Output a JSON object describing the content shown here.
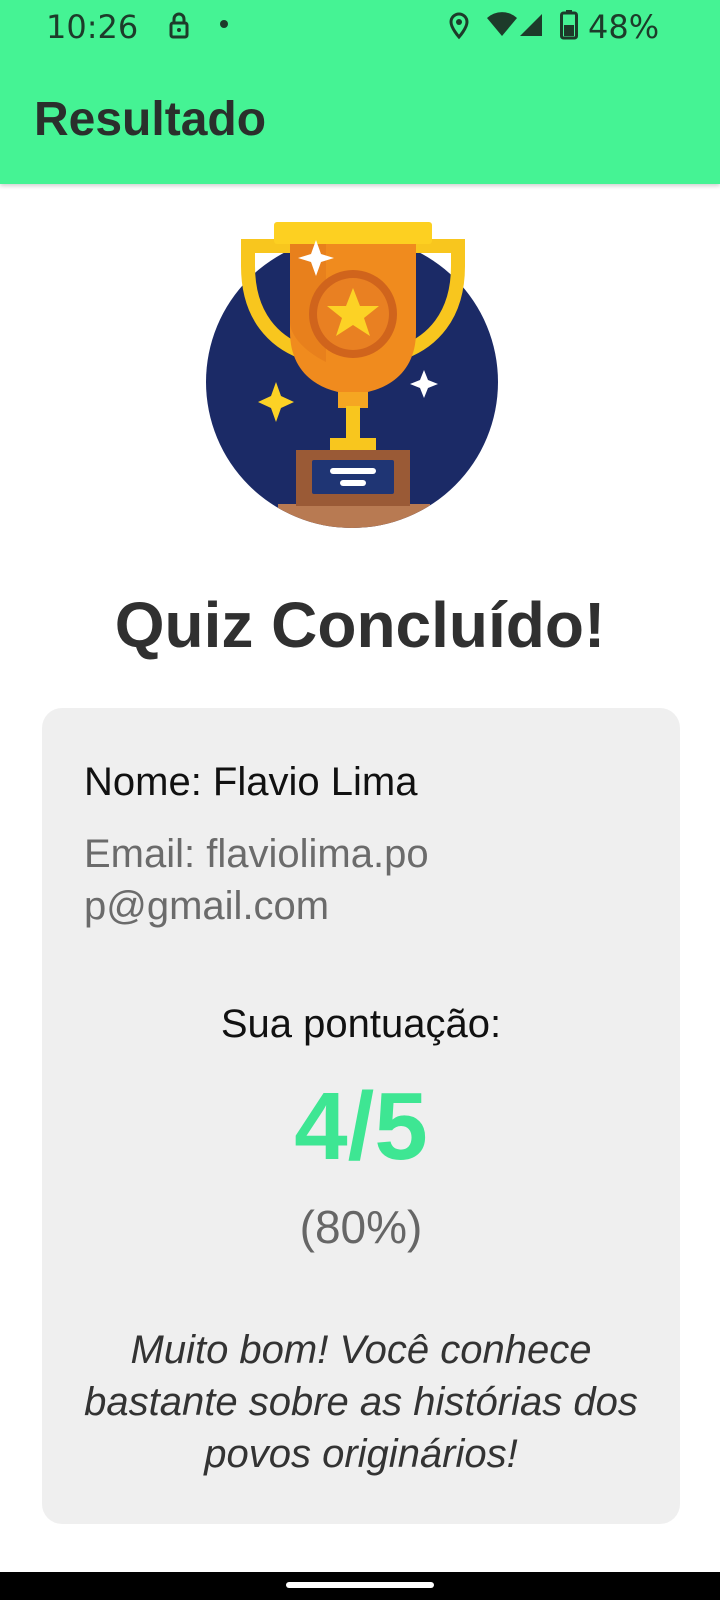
{
  "status_bar": {
    "time": "10:26",
    "battery_percent": "48%",
    "icons": [
      "lock-icon",
      "notification-dot-icon",
      "location-icon",
      "wifi-icon",
      "signal-icon",
      "battery-icon"
    ]
  },
  "app_bar": {
    "title": "Resultado",
    "color": "#45f394"
  },
  "result": {
    "heading": "Quiz Concluído!",
    "name_line": "Nome: Flavio Lima",
    "email_line": "Email: flaviolima.pop@gmail.com",
    "score_label": "Sua pontuação:",
    "score_value": "4/5",
    "score_percent": "(80%)",
    "message": "Muito bom! Você conhece bastante sobre as histórias dos povos originários!",
    "score_color": "#3ee693"
  }
}
